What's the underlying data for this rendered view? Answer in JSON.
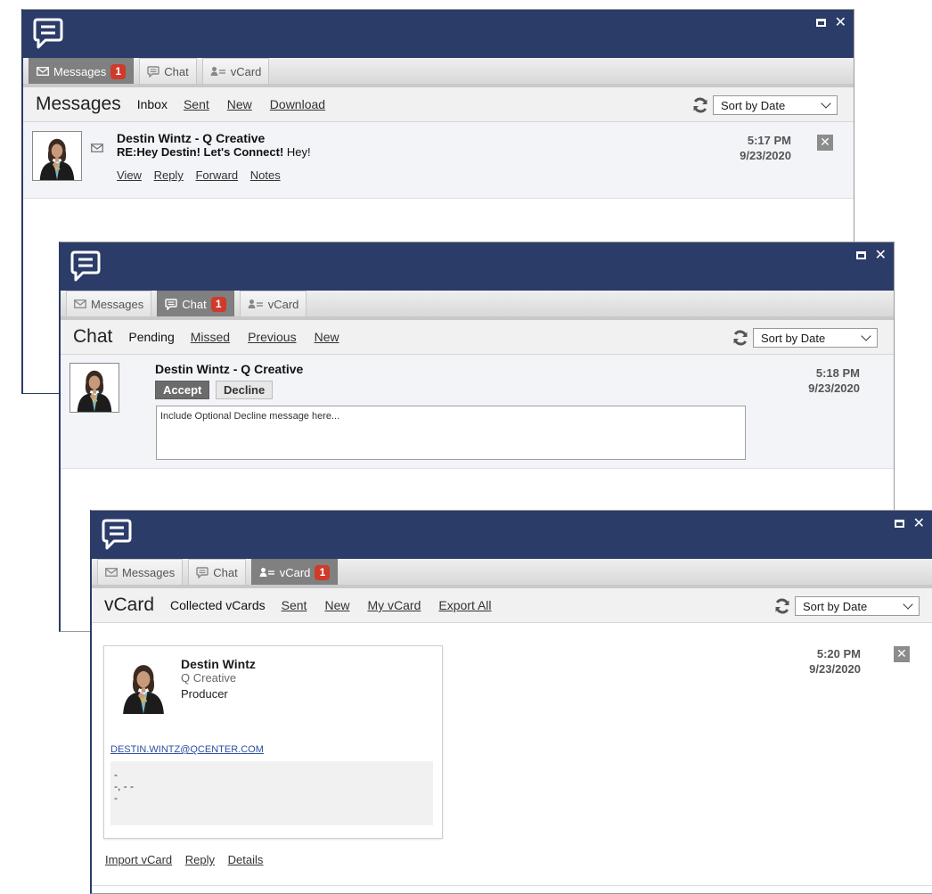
{
  "colors": {
    "titlebar": "#2b3c68",
    "badge": "#cf3a2a",
    "active_tab": "#808080",
    "row_bg": "#f2f4f8"
  },
  "tabs": {
    "messages": "Messages",
    "chat": "Chat",
    "vcard": "vCard"
  },
  "messages_window": {
    "tab_badge": "1",
    "toolbar": {
      "title": "Messages",
      "current": "Inbox",
      "links": [
        "Sent",
        "New",
        "Download"
      ]
    },
    "sort": "Sort by Date",
    "item": {
      "sender": "Destin Wintz - Q Creative",
      "subject": "RE:Hey Destin! Let's Connect!",
      "preview": "Hey!",
      "actions": [
        "View",
        "Reply",
        "Forward",
        "Notes"
      ],
      "time": "5:17 PM",
      "date": "9/23/2020"
    }
  },
  "chat_window": {
    "tab_badge": "1",
    "toolbar": {
      "title": "Chat",
      "current": "Pending",
      "links": [
        "Missed",
        "Previous",
        "New"
      ]
    },
    "sort": "Sort by Date",
    "item": {
      "sender": "Destin Wintz - Q Creative",
      "accept": "Accept",
      "decline": "Decline",
      "decline_placeholder": "Include Optional Decline message here...",
      "time": "5:18 PM",
      "date": "9/23/2020"
    }
  },
  "vcard_window": {
    "tab_badge": "1",
    "toolbar": {
      "title": "vCard",
      "current": "Collected vCards",
      "links": [
        "Sent",
        "New",
        "My vCard",
        "Export All"
      ]
    },
    "sort": "Sort by Date",
    "card": {
      "name": "Destin Wintz",
      "company": "Q Creative",
      "title": "Producer",
      "email": "DESTIN.WINTZ@QCENTER.COM",
      "address_lines": [
        "-",
        "-, - -",
        "-"
      ]
    },
    "time": "5:20 PM",
    "date": "9/23/2020",
    "footer_actions": [
      "Import vCard",
      "Reply",
      "Details"
    ]
  }
}
